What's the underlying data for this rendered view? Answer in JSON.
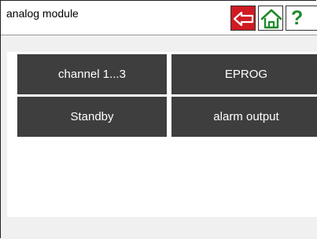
{
  "header": {
    "title": "analog module",
    "buttons": [
      {
        "icon": "back-arrow-icon",
        "color": "#d01a22"
      },
      {
        "icon": "home-icon",
        "color": "#1f8a2a"
      },
      {
        "icon": "help-icon",
        "label": "?",
        "color": "#1f8a2a"
      }
    ]
  },
  "menu": {
    "items": [
      {
        "label": "channel 1...3"
      },
      {
        "label": "EPROG"
      },
      {
        "label": "Standby"
      },
      {
        "label": "alarm output"
      }
    ],
    "tile_color": "#3e3e3e"
  }
}
